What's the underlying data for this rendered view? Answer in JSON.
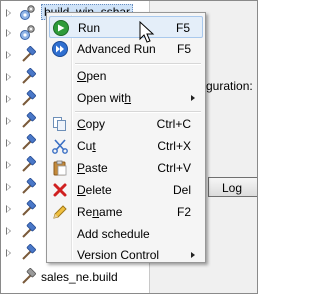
{
  "tree": {
    "items": [
      {
        "label": "build_win_sshar",
        "icon": "gears-icon",
        "expandable": true,
        "selected": true
      },
      {
        "label": "",
        "icon": "gears-icon",
        "expandable": true
      },
      {
        "label": "",
        "icon": "hammer-icon",
        "expandable": true
      },
      {
        "label": "",
        "icon": "hammer-icon",
        "expandable": true
      },
      {
        "label": "",
        "icon": "hammer-icon",
        "expandable": true
      },
      {
        "label": "",
        "icon": "hammer-icon",
        "expandable": true
      },
      {
        "label": "",
        "icon": "hammer-icon",
        "expandable": true
      },
      {
        "label": "",
        "icon": "hammer-icon",
        "expandable": true
      },
      {
        "label": "",
        "icon": "hammer-icon",
        "expandable": true
      },
      {
        "label": "",
        "icon": "hammer-icon",
        "expandable": true
      },
      {
        "label": "",
        "icon": "hammer-icon",
        "expandable": true
      },
      {
        "label": "",
        "icon": "hammer-icon",
        "expandable": true
      },
      {
        "label": "",
        "icon": "hammer-icon",
        "expandable": true
      },
      {
        "label": "",
        "icon": "hammer-icon",
        "expandable": true
      },
      {
        "label": "sales_ne.build",
        "icon": "hammer-icon",
        "expandable": false
      }
    ]
  },
  "panel": {
    "config_text": "guration:",
    "log_button": "Log"
  },
  "context_menu": {
    "run": {
      "label": "Run",
      "shortcut": "F5"
    },
    "advanced_run": {
      "label": "Advanced Run",
      "shortcut": "F5"
    },
    "open": {
      "label_u": "O",
      "label_rest": "pen"
    },
    "open_with": {
      "label_pre": "Open wit",
      "label_u": "h"
    },
    "copy": {
      "label_u": "C",
      "label_rest": "opy",
      "shortcut": "Ctrl+C"
    },
    "cut": {
      "label_pre": "Cu",
      "label_u": "t",
      "shortcut": "Ctrl+X"
    },
    "paste": {
      "label_u": "P",
      "label_rest": "aste",
      "shortcut": "Ctrl+V"
    },
    "delete": {
      "label_u": "D",
      "label_rest": "elete",
      "shortcut": "Del"
    },
    "rename": {
      "label_pre": "Re",
      "label_u": "n",
      "label_rest": "ame",
      "shortcut": "F2"
    },
    "add_schedule": {
      "label": "Add schedule"
    },
    "version_control": {
      "label": "Version Control"
    }
  },
  "colors": {
    "run_icon": "#2e9b3a",
    "advanced_run_icon": "#2f6fd0",
    "delete_icon": "#d02020",
    "menu_highlight": "#e4eef9"
  }
}
